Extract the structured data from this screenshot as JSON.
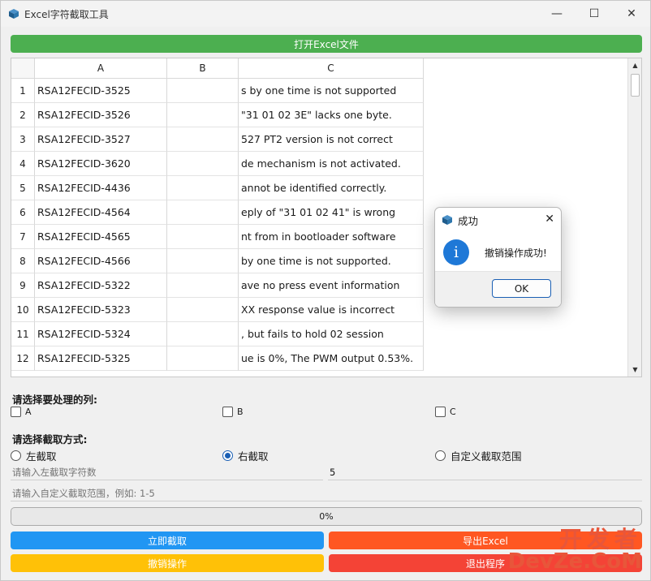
{
  "window": {
    "title": "Excel字符截取工具",
    "min": "—",
    "max": "☐",
    "close": "✕"
  },
  "open_button": "打开Excel文件",
  "table": {
    "columns": [
      "A",
      "B",
      "C"
    ],
    "rows": [
      {
        "n": "1",
        "a": "RSA12FECID-3525",
        "b": "",
        "c": "s by one time is not supported"
      },
      {
        "n": "2",
        "a": "RSA12FECID-3526",
        "b": "",
        "c": " \"31 01 02 3E\" lacks one byte."
      },
      {
        "n": "3",
        "a": "RSA12FECID-3527",
        "b": "",
        "c": "527 PT2 version is not correct"
      },
      {
        "n": "4",
        "a": "RSA12FECID-3620",
        "b": "",
        "c": "de mechanism is not activated."
      },
      {
        "n": "5",
        "a": "RSA12FECID-4436",
        "b": "",
        "c": "annot be identified correctly."
      },
      {
        "n": "6",
        "a": "RSA12FECID-4564",
        "b": "",
        "c": "eply of \"31 01 02 41\" is wrong"
      },
      {
        "n": "7",
        "a": "RSA12FECID-4565",
        "b": "",
        "c": "nt from in bootloader software"
      },
      {
        "n": "8",
        "a": "RSA12FECID-4566",
        "b": "",
        "c": " by one time is not supported."
      },
      {
        "n": "9",
        "a": "RSA12FECID-5322",
        "b": "",
        "c": "ave no press event information"
      },
      {
        "n": "10",
        "a": "RSA12FECID-5323",
        "b": "",
        "c": "XX response value is incorrect"
      },
      {
        "n": "11",
        "a": "RSA12FECID-5324",
        "b": "",
        "c": ", but fails to hold 02 session"
      },
      {
        "n": "12",
        "a": "RSA12FECID-5325",
        "b": "",
        "c": "ue is 0%, The PWM output 0.53%."
      }
    ]
  },
  "columns_section": {
    "label": "请选择要处理的列:",
    "options": [
      "A",
      "B",
      "C"
    ]
  },
  "mode_section": {
    "label": "请选择截取方式:",
    "options": [
      "左截取",
      "右截取",
      "自定义截取范围"
    ],
    "selected": "右截取"
  },
  "inputs": {
    "left_count_placeholder": "请输入左截取字符数",
    "right_count_value": "5",
    "range_placeholder": "请输入自定义截取范围，例如: 1-5"
  },
  "progress": {
    "text": "0%",
    "value": 0
  },
  "buttons": {
    "cut_now": "立即截取",
    "export": "导出Excel",
    "undo": "撤销操作",
    "exit": "退出程序"
  },
  "dialog": {
    "title": "成功",
    "message": "撤销操作成功!",
    "ok": "OK",
    "close": "✕",
    "info_glyph": "i"
  },
  "watermark": {
    "top": "开发者",
    "bottom": "DevZe.CoM"
  },
  "colors": {
    "green": "#4caf50",
    "blue": "#2196f3",
    "orange": "#ff5722",
    "amber": "#ffc107",
    "red": "#f44336"
  }
}
